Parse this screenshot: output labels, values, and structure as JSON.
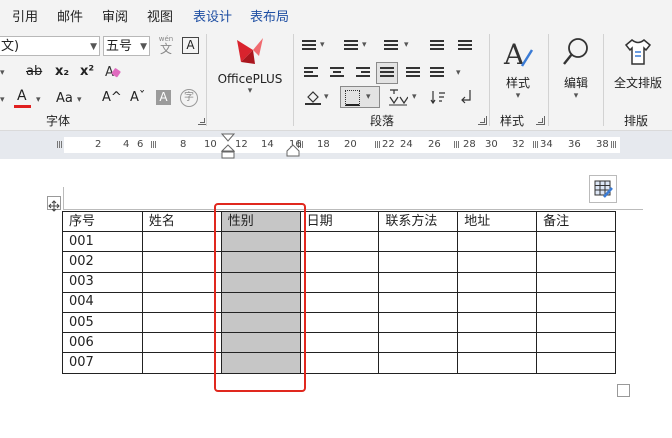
{
  "tabs": [
    {
      "label": "引用"
    },
    {
      "label": "邮件"
    },
    {
      "label": "审阅"
    },
    {
      "label": "视图"
    },
    {
      "label": "表设计"
    },
    {
      "label": "表布局"
    }
  ],
  "font_group": {
    "font_name": "文)",
    "font_size": "五号",
    "wen_glyph": "文",
    "wen_pinyin": "wén",
    "boxed_a": "A",
    "strike_label": "ab",
    "subscript_label": "x₂",
    "superscript_label": "x²",
    "font_color_label": "A",
    "font_color": "#e02020",
    "change_case_label": "Aa",
    "grow_font_label": "A^",
    "shrink_font_label": "Aˇ",
    "char_shading_label": "A",
    "enclose_char_label": "字",
    "group_label": "字体"
  },
  "officeplus": {
    "label": "OfficePLUS",
    "brand_color": "#d9232d"
  },
  "paragraph": {
    "group_label": "段落"
  },
  "styles": {
    "label": "样式",
    "group_label": "样式"
  },
  "editing": {
    "label": "编辑"
  },
  "layout": {
    "label": "全文排版",
    "group_label": "排版"
  },
  "ruler": {
    "numbers": [
      "2",
      "4",
      "6",
      "8",
      "10",
      "12",
      "14",
      "16",
      "18",
      "20",
      "22",
      "24",
      "26",
      "28",
      "30",
      "32",
      "34",
      "36",
      "38"
    ]
  },
  "table": {
    "headers": [
      "序号",
      "姓名",
      "性别",
      "日期",
      "联系方法",
      "地址",
      "备注"
    ],
    "rows": [
      [
        "001",
        "",
        "",
        "",
        "",
        "",
        ""
      ],
      [
        "002",
        "",
        "",
        "",
        "",
        "",
        ""
      ],
      [
        "003",
        "",
        "",
        "",
        "",
        "",
        ""
      ],
      [
        "004",
        "",
        "",
        "",
        "",
        "",
        ""
      ],
      [
        "005",
        "",
        "",
        "",
        "",
        "",
        ""
      ],
      [
        "006",
        "",
        "",
        "",
        "",
        "",
        ""
      ],
      [
        "007",
        "",
        "",
        "",
        "",
        "",
        ""
      ]
    ],
    "selected_column": "性别",
    "highlight_color": "#e0281e"
  }
}
